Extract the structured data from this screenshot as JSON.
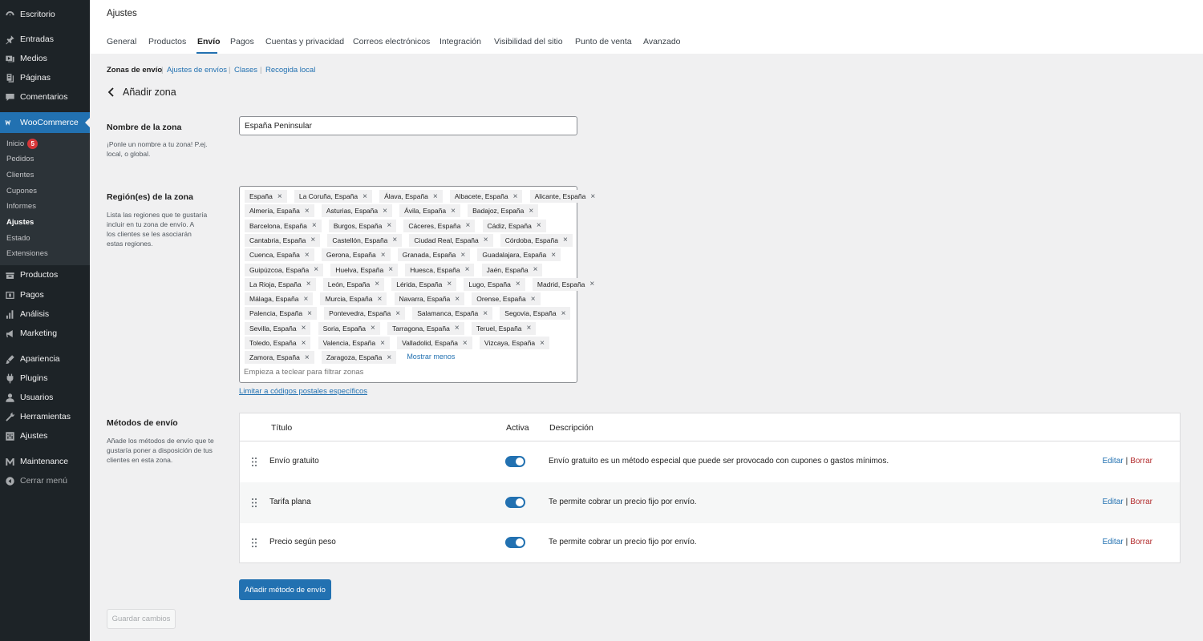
{
  "sidebar": {
    "items": [
      {
        "label": "Escritorio",
        "icon": "dashboard-icon"
      },
      {
        "label": "Entradas",
        "icon": "pin-icon"
      },
      {
        "label": "Medios",
        "icon": "media-icon"
      },
      {
        "label": "Páginas",
        "icon": "pages-icon"
      },
      {
        "label": "Comentarios",
        "icon": "comments-icon"
      },
      {
        "label": "WooCommerce",
        "icon": "woocommerce-icon"
      },
      {
        "label": "Productos",
        "icon": "products-icon"
      },
      {
        "label": "Pagos",
        "icon": "payments-icon"
      },
      {
        "label": "Análisis",
        "icon": "analytics-icon"
      },
      {
        "label": "Marketing",
        "icon": "marketing-icon"
      },
      {
        "label": "Apariencia",
        "icon": "appearance-icon"
      },
      {
        "label": "Plugins",
        "icon": "plugins-icon"
      },
      {
        "label": "Usuarios",
        "icon": "users-icon"
      },
      {
        "label": "Herramientas",
        "icon": "tools-icon"
      },
      {
        "label": "Ajustes",
        "icon": "settings-icon"
      },
      {
        "label": "Maintenance",
        "icon": "maintenance-icon"
      },
      {
        "label": "Cerrar menú",
        "icon": "collapse-icon"
      }
    ],
    "submenu": [
      {
        "label": "Inicio",
        "badge": "5"
      },
      {
        "label": "Pedidos"
      },
      {
        "label": "Clientes"
      },
      {
        "label": "Cupones"
      },
      {
        "label": "Informes"
      },
      {
        "label": "Ajustes"
      },
      {
        "label": "Estado"
      },
      {
        "label": "Extensiones"
      }
    ]
  },
  "header": {
    "title": "Ajustes",
    "tabs": [
      "General",
      "Productos",
      "Envío",
      "Pagos",
      "Cuentas y privacidad",
      "Correos electrónicos",
      "Integración",
      "Visibilidad del sitio",
      "Punto de venta",
      "Avanzado"
    ],
    "active_tab": "Envío"
  },
  "subnav": [
    "Zonas de envío",
    "Ajustes de envíos",
    "Clases",
    "Recogida local"
  ],
  "page": {
    "heading": "Añadir zona",
    "zone_name_label": "Nombre de la zona",
    "zone_name_desc_1": "¡Ponle un nombre a tu zona! P.ej.",
    "zone_name_desc_2": "local, o global.",
    "zone_name_value": "España Peninsular",
    "regions_label": "Región(es) de la zona",
    "regions_desc": [
      "Lista las regiones que te gustaría",
      "incluir en tu zona de envío. A",
      "los clientes se les asociarán",
      "estas regiones."
    ],
    "regions": [
      [
        "España",
        "La Coruña, España",
        "Álava, España",
        "Albacete, España",
        "Alicante, España"
      ],
      [
        "Almería, España",
        "Asturias, España",
        "Ávila, España",
        "Badajoz, España"
      ],
      [
        "Barcelona, España",
        "Burgos, España",
        "Cáceres, España",
        "Cádiz, España"
      ],
      [
        "Cantabria, España",
        "Castellón, España",
        "Ciudad Real, España",
        "Córdoba, España"
      ],
      [
        "Cuenca, España",
        "Gerona, España",
        "Granada, España",
        "Guadalajara, España"
      ],
      [
        "Guipúzcoa, España",
        "Huelva, España",
        "Huesca, España",
        "Jaén, España"
      ],
      [
        "La Rioja, España",
        "León, España",
        "Lérida, España",
        "Lugo, España",
        "Madrid, España"
      ],
      [
        "Málaga, España",
        "Murcia, España",
        "Navarra, España",
        "Orense, España"
      ],
      [
        "Palencia, España",
        "Pontevedra, España",
        "Salamanca, España",
        "Segovia, España"
      ],
      [
        "Sevilla, España",
        "Soria, España",
        "Tarragona, España",
        "Teruel, España"
      ],
      [
        "Toledo, España",
        "Valencia, España",
        "Valladolid, España",
        "Vizcaya, España"
      ],
      [
        "Zamora, España",
        "Zaragoza, España"
      ]
    ],
    "show_less": "Mostrar menos",
    "region_filter_placeholder": "Empieza a teclear para filtrar zonas",
    "postal_link": "Limitar a códigos postales específicos",
    "methods_label": "Métodos de envío",
    "methods_desc": [
      "Añade los métodos de envío que te",
      "gustaría poner a disposición de tus",
      "clientes en esta zona."
    ],
    "methods_headers": {
      "title": "Título",
      "active": "Activa",
      "description": "Descripción"
    },
    "methods": [
      {
        "name": "Envío gratuito",
        "enabled": true,
        "description": "Envío gratuito es un método especial que puede ser provocado con cupones o gastos mínimos.",
        "edit": "Editar",
        "delete": "Borrar"
      },
      {
        "name": "Tarifa plana",
        "enabled": true,
        "description": "Te permite cobrar un precio fijo por envío.",
        "edit": "Editar",
        "delete": "Borrar"
      },
      {
        "name": "Precio según peso",
        "enabled": true,
        "description": "Te permite cobrar un precio fijo por envío.",
        "edit": "Editar",
        "delete": "Borrar"
      }
    ],
    "add_method_button": "Añadir método de envío",
    "save_button": "Guardar cambios"
  },
  "colors": {
    "accent": "#2271b1",
    "sidebar_bg": "#1d2327",
    "delete": "#b32d2e",
    "badge": "#d63638"
  }
}
